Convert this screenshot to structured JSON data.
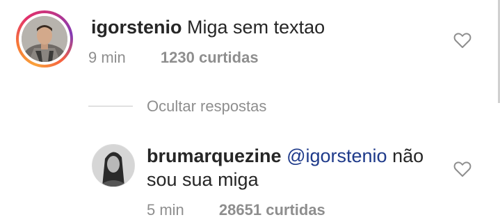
{
  "comments": [
    {
      "username": "igorstenio",
      "text": "Miga sem textao",
      "time": "9 min",
      "likes": "1230 curtidas",
      "avatar_icon": "profile-photo-with-story-ring",
      "like_icon": "heart-outline-icon"
    }
  ],
  "replies_toggle": {
    "label": "Ocultar respostas"
  },
  "replies": [
    {
      "username": "brumarquezine",
      "mention": "@igorstenio",
      "text_line1_rest": "não",
      "text_line2": "sou sua miga",
      "time": "5 min",
      "likes": "28651 curtidas",
      "avatar_icon": "profile-photo",
      "like_icon": "heart-outline-icon"
    }
  ],
  "colors": {
    "text": "#262626",
    "secondary": "#8e8e8e",
    "mention": "#1e3a8a",
    "story_ring_start": "#f9a13a",
    "story_ring_end": "#c13584"
  }
}
